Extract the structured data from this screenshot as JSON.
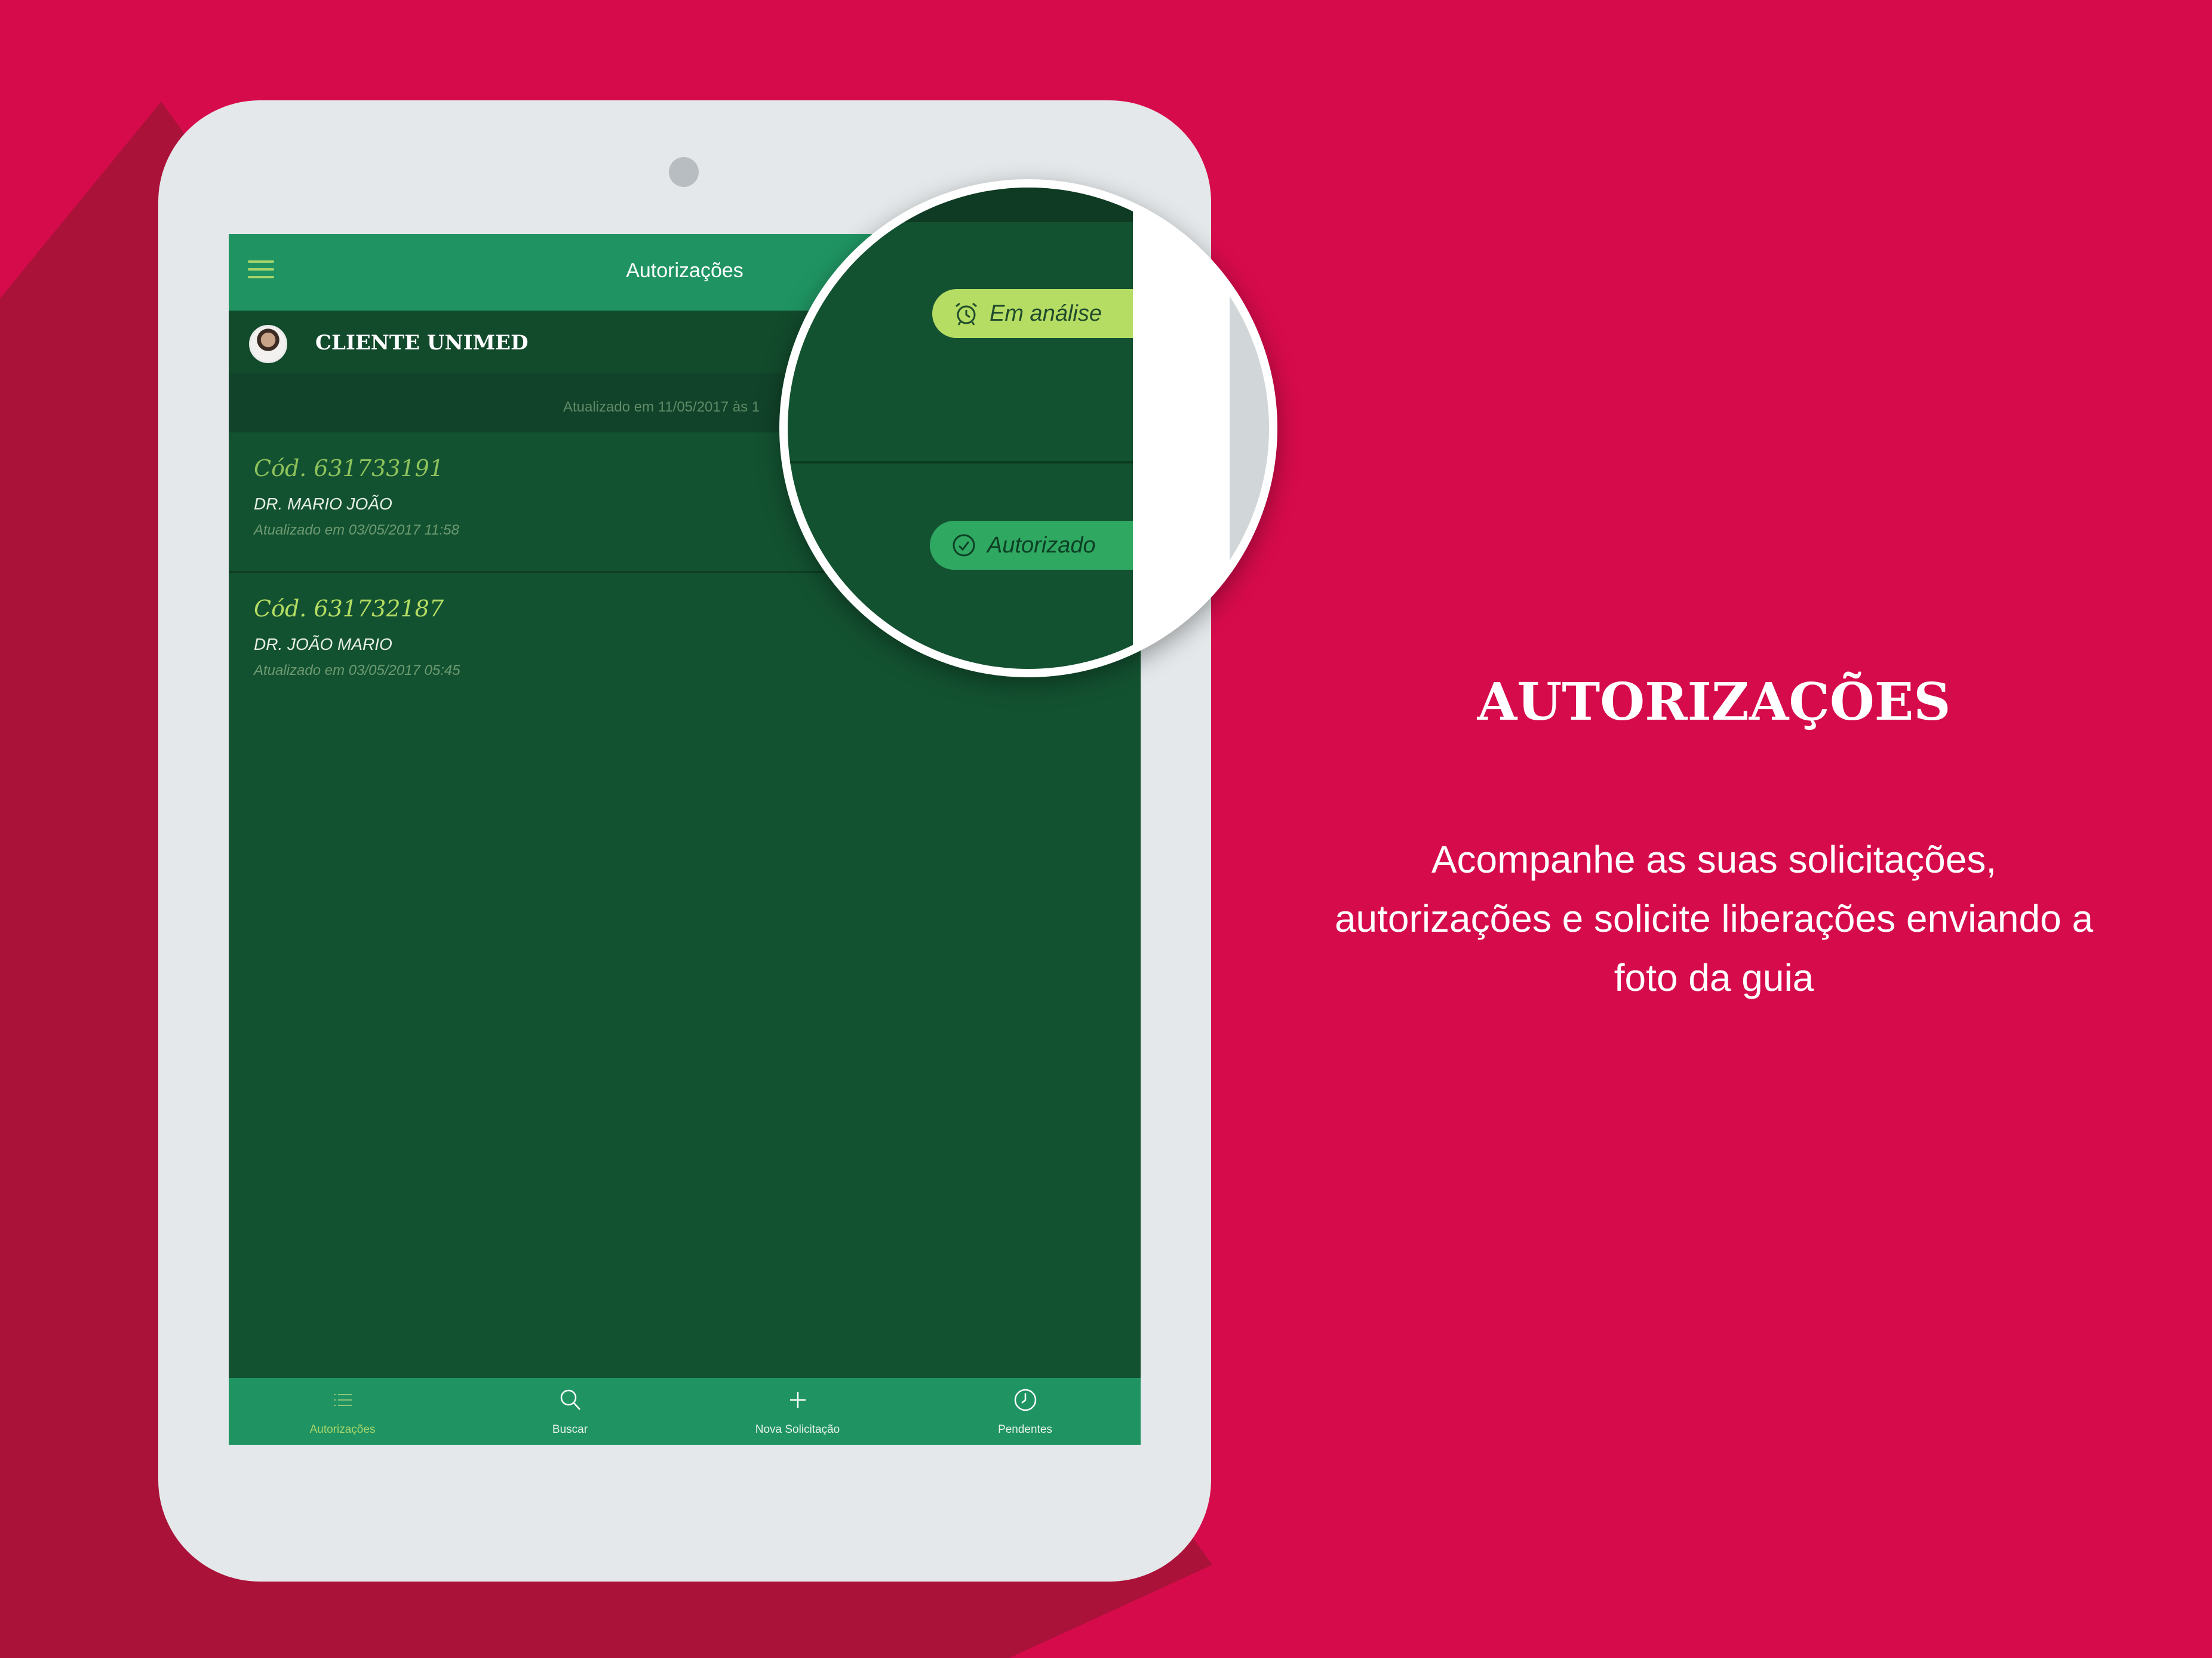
{
  "app": {
    "title": "Autorizações",
    "user_name": "CLIENTE UNIMED",
    "last_updated": "Atualizado em 11/05/2017 às 1"
  },
  "authorizations": [
    {
      "code": "Cód. 631733191",
      "doctor": "DR. MARIO JOÃO",
      "updated": "Atualizado em 03/05/2017 11:58"
    },
    {
      "code": "Cód. 631732187",
      "doctor": "DR. JOÃO MARIO",
      "updated": "Atualizado em 03/05/2017 05:45"
    }
  ],
  "status_badges": {
    "in_review": "Em análise",
    "authorized": "Autorizado"
  },
  "tabs": [
    {
      "label": "Autorizações",
      "icon": "list-icon",
      "active": true
    },
    {
      "label": "Buscar",
      "icon": "search-icon",
      "active": false
    },
    {
      "label": "Nova Solicitação",
      "icon": "plus-icon",
      "active": false
    },
    {
      "label": "Pendentes",
      "icon": "clock-icon",
      "active": false
    }
  ],
  "promo": {
    "heading": "AUTORIZAÇÕES",
    "body_lines": [
      "Acompanhe as suas solicitações,",
      "autorizações e solicite liberações enviando a",
      "foto da guia"
    ]
  },
  "colors": {
    "background": "#d60b4c",
    "app_green": "#1f9462",
    "screen_dark_green": "#135231",
    "accent_lime": "#b5dd63",
    "authorized_green": "#2fa862"
  }
}
